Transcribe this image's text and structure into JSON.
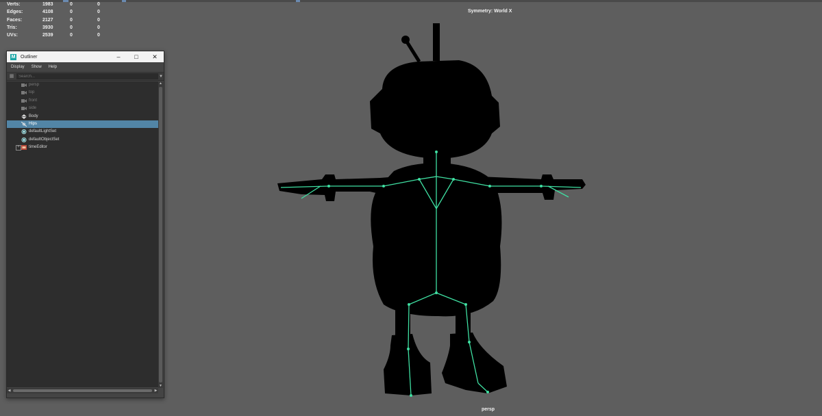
{
  "hud": {
    "rows": [
      {
        "label": "Verts:",
        "v0": "1983",
        "v1": "0",
        "v2": "0"
      },
      {
        "label": "Edges:",
        "v0": "4108",
        "v1": "0",
        "v2": "0"
      },
      {
        "label": "Faces:",
        "v0": "2127",
        "v1": "0",
        "v2": "0"
      },
      {
        "label": "Tris:",
        "v0": "3930",
        "v1": "0",
        "v2": "0"
      },
      {
        "label": "UVs:",
        "v0": "2539",
        "v1": "0",
        "v2": "0"
      }
    ]
  },
  "viewport": {
    "symmetry": "Symmetry: World X",
    "camera": "persp",
    "background_color": "#5e5e5e",
    "joint_color": "#3fe0a2"
  },
  "outliner": {
    "title": "Outliner",
    "menus": [
      "Display",
      "Show",
      "Help"
    ],
    "search_placeholder": "Search...",
    "items": [
      {
        "label": "persp",
        "icon": "camera-icon",
        "dim": true
      },
      {
        "label": "top",
        "icon": "camera-icon",
        "dim": true
      },
      {
        "label": "front",
        "icon": "camera-icon",
        "dim": true
      },
      {
        "label": "side",
        "icon": "camera-icon",
        "dim": true
      },
      {
        "label": "Body",
        "icon": "mesh-icon",
        "dim": false
      },
      {
        "label": "Hips",
        "icon": "joint-icon",
        "dim": false,
        "selected": true
      },
      {
        "label": "defaultLightSet",
        "icon": "set-icon",
        "dim": false
      },
      {
        "label": "defaultObjectSet",
        "icon": "set-icon",
        "dim": false
      },
      {
        "label": "timeEditor",
        "icon": "time-editor-icon",
        "dim": false,
        "expandable": true
      }
    ],
    "accent_color": "#5285a6"
  }
}
